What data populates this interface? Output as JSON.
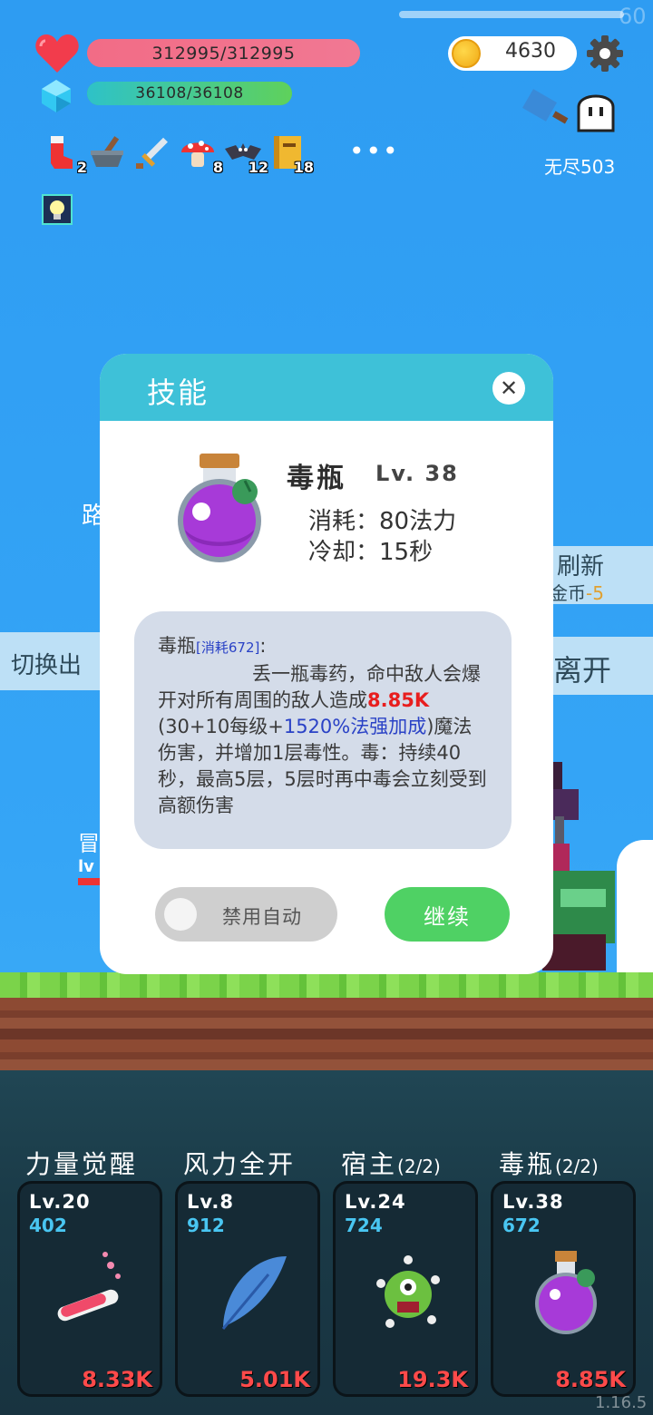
{
  "hud": {
    "fps": "60",
    "hp": {
      "text": "312995/312995",
      "fraction": 1.0,
      "color": "#f07088"
    },
    "mp": {
      "text": "36108/36108",
      "fraction": 1.0,
      "color": "#4bc86a"
    },
    "coins": "4630",
    "endless_label": "无尽503"
  },
  "inventory": [
    {
      "icon": "red-sock-icon",
      "count": "2"
    },
    {
      "icon": "mortar-icon",
      "count": ""
    },
    {
      "icon": "sword-icon",
      "count": ""
    },
    {
      "icon": "mushroom-icon",
      "count": "8"
    },
    {
      "icon": "bat-icon",
      "count": "12"
    },
    {
      "icon": "book-icon",
      "count": "18"
    }
  ],
  "more_label": "•••",
  "background": {
    "path_label": "路",
    "switch_label": "切换出",
    "refresh_label": "刷新",
    "refresh_sub": "金币",
    "refresh_cost": "-5",
    "leave_label": "离开",
    "adventure_label": "冒",
    "adventure_sub": "lv"
  },
  "dialog": {
    "title": "技能",
    "skill_name": "毒瓶",
    "skill_level": "Lv. 38",
    "cost_line": "消耗：80法力",
    "cooldown_line": "冷却：15秒",
    "desc_name": "毒瓶",
    "desc_cost": "[消耗672]",
    "desc_colon": ":",
    "desc_part1": "丢一瓶毒药，命中敌人会爆开对所有周围的敌人造成",
    "desc_damage": "8.85K",
    "desc_part2": " (30+10每级+",
    "desc_bonus": "1520%法强加成",
    "desc_part3": ")魔法伤害，并增加1层毒性。毒：持续40秒，最高5层，5层时再中毒会立刻受到高额伤害",
    "auto_toggle_label": "禁用自动",
    "continue_label": "继续"
  },
  "skills": [
    {
      "name": "力量觉醒",
      "charges": "",
      "level": "Lv.20",
      "cost": "402",
      "damage": "8.33K",
      "icon": "red-vial-icon"
    },
    {
      "name": "风力全开",
      "charges": "",
      "level": "Lv.8",
      "cost": "912",
      "damage": "5.01K",
      "icon": "feather-icon"
    },
    {
      "name": "宿主",
      "charges": "(2/2)",
      "level": "Lv.24",
      "cost": "724",
      "damage": "19.3K",
      "icon": "green-monster-icon"
    },
    {
      "name": "毒瓶",
      "charges": "(2/2)",
      "level": "Lv.38",
      "cost": "672",
      "damage": "8.85K",
      "icon": "poison-bottle-icon"
    }
  ],
  "version": "1.16.5"
}
